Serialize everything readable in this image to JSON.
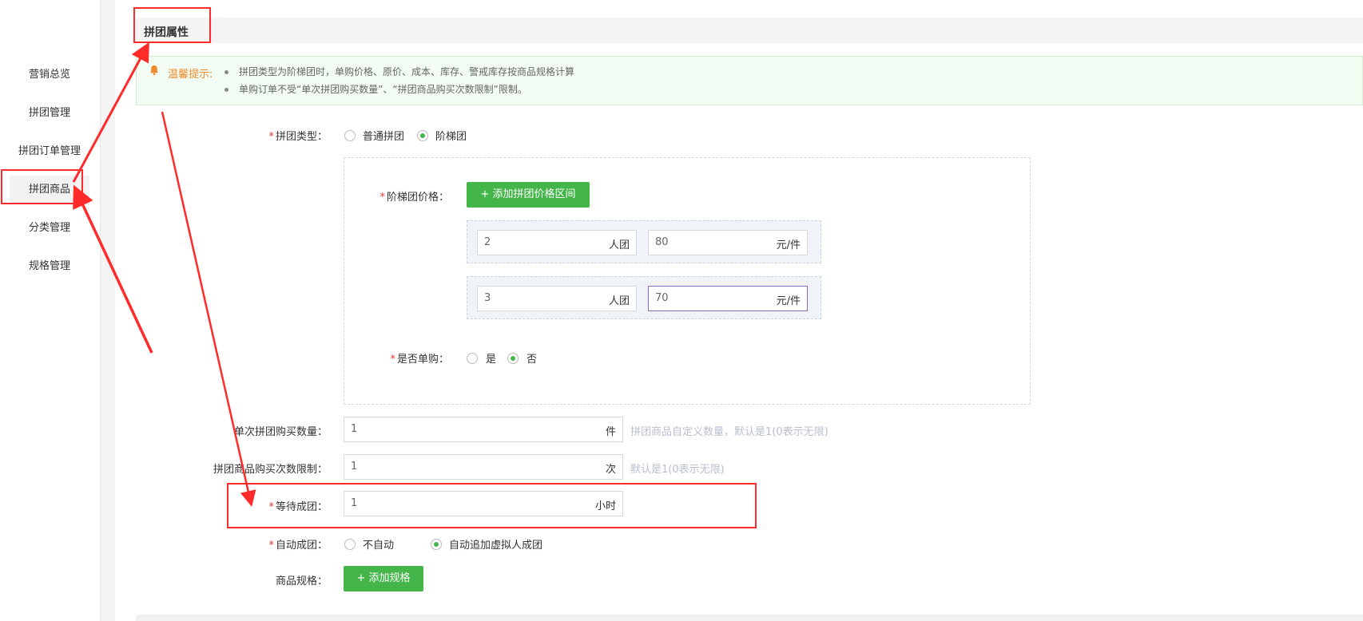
{
  "sidebar": {
    "items": [
      {
        "label": "营销总览",
        "active": false
      },
      {
        "label": "拼团管理",
        "active": false
      },
      {
        "label": "拼团订单管理",
        "active": false
      },
      {
        "label": "拼团商品",
        "active": true
      },
      {
        "label": "分类管理",
        "active": false
      },
      {
        "label": "规格管理",
        "active": false
      }
    ]
  },
  "section": {
    "title": "拼团属性"
  },
  "tip": {
    "label": "温馨提示:",
    "lines": [
      "拼团类型为阶梯团时，单购价格、原价、成本、库存、警戒库存按商品规格计算",
      "单购订单不受“单次拼团购买数量”、“拼团商品购买次数限制”限制。"
    ]
  },
  "form": {
    "group_type": {
      "label": "拼团类型：",
      "options": [
        "普通拼团",
        "阶梯团"
      ],
      "selected": "阶梯团"
    },
    "ladder": {
      "price_label": "阶梯团价格：",
      "add_button": "+ 添加拼团价格区间",
      "tiers": [
        {
          "people": "2",
          "people_unit": "人团",
          "price": "80",
          "price_unit": "元/件"
        },
        {
          "people": "3",
          "people_unit": "人团",
          "price": "70",
          "price_unit": "元/件"
        }
      ],
      "single_buy": {
        "label": "是否单购：",
        "options": [
          "是",
          "否"
        ],
        "selected": "否"
      }
    },
    "per_purchase": {
      "label": "单次拼团购买数量：",
      "value": "1",
      "unit": "件",
      "hint": "拼团商品自定义数量，默认是1(0表示无限)"
    },
    "purchase_limit": {
      "label": "拼团商品购买次数限制：",
      "value": "1",
      "unit": "次",
      "hint": "默认是1(0表示无限)"
    },
    "wait_time": {
      "label": "等待成团：",
      "value": "1",
      "unit": "小时"
    },
    "auto_group": {
      "label": "自动成团：",
      "options": [
        "不自动",
        "自动追加虚拟人成团"
      ],
      "selected": "自动追加虚拟人成团"
    },
    "spec": {
      "label": "商品规格：",
      "button": "+ 添加规格"
    }
  },
  "colors": {
    "accent_green": "#44b549",
    "warning_orange": "#f08c2e",
    "annotation_red": "#ff2a2a",
    "focus_purple": "#8b6cc9"
  }
}
